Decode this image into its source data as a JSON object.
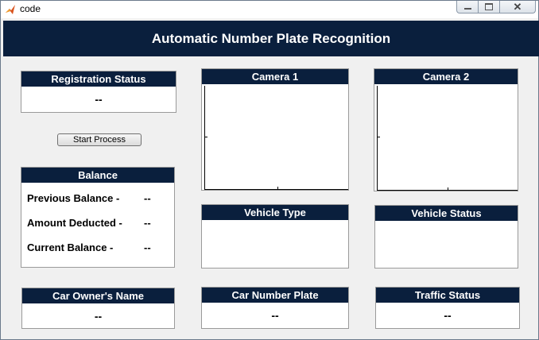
{
  "window": {
    "title": "code",
    "close_glyph": "✕",
    "icon": "matlab-icon"
  },
  "header": {
    "title": "Automatic Number Plate Recognition"
  },
  "registration": {
    "label": "Registration Status",
    "value": "--"
  },
  "start_button": {
    "label": "Start Process"
  },
  "balance": {
    "label": "Balance",
    "rows": [
      {
        "label": "Previous Balance -",
        "value": "--"
      },
      {
        "label": "Amount Deducted -",
        "value": "--"
      },
      {
        "label": "Current Balance  -",
        "value": "--"
      }
    ]
  },
  "owner": {
    "label": "Car Owner's Name",
    "value": "--"
  },
  "camera1": {
    "label": "Camera 1"
  },
  "camera2": {
    "label": "Camera 2"
  },
  "vehicle_type": {
    "label": "Vehicle Type"
  },
  "vehicle_status": {
    "label": "Vehicle Status"
  },
  "plate": {
    "label": "Car Number Plate",
    "value": "--"
  },
  "traffic": {
    "label": "Traffic Status",
    "value": "--"
  },
  "colors": {
    "header_bg": "#0a1f3d",
    "window_bg": "#f0f0f0",
    "panel_bg": "#ffffff"
  }
}
